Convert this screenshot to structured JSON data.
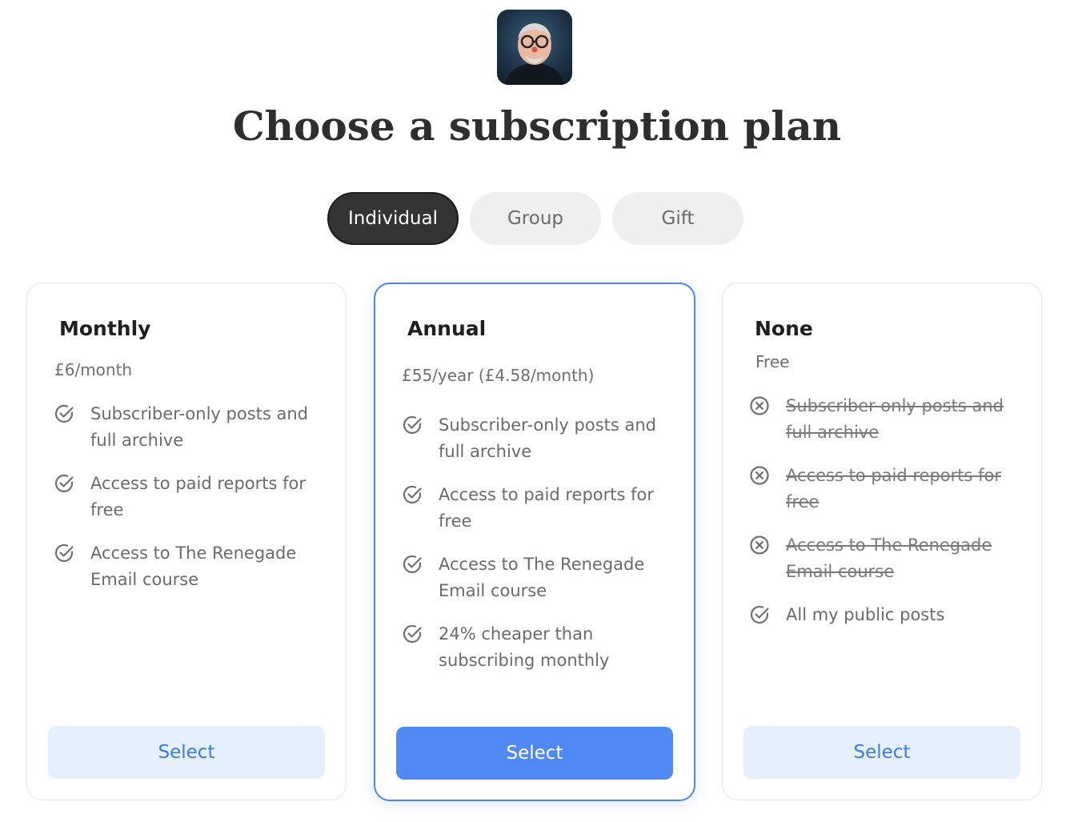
{
  "page": {
    "title": "Choose a subscription plan"
  },
  "tabs": [
    {
      "label": "Individual",
      "active": true
    },
    {
      "label": "Group",
      "active": false
    },
    {
      "label": "Gift",
      "active": false
    }
  ],
  "plans": [
    {
      "name": "Monthly",
      "price": "£6/month",
      "features": [
        {
          "text": "Subscriber-only posts and full archive",
          "included": true
        },
        {
          "text": "Access to paid reports for free",
          "included": true
        },
        {
          "text": "Access to The Renegade Email course",
          "included": true
        }
      ],
      "button": "Select"
    },
    {
      "name": "Annual",
      "price": "£55/year (£4.58/month)",
      "features": [
        {
          "text": "Subscriber-only posts and full archive",
          "included": true
        },
        {
          "text": "Access to paid reports for free",
          "included": true
        },
        {
          "text": "Access to The Renegade Email course",
          "included": true
        },
        {
          "text": "24% cheaper than subscribing monthly",
          "included": true
        }
      ],
      "button": "Select"
    },
    {
      "name": "None",
      "price": "Free",
      "features": [
        {
          "text": "Subscriber-only posts and full archive",
          "included": false
        },
        {
          "text": "Access to paid reports for free",
          "included": false
        },
        {
          "text": "Access to The Renegade Email course",
          "included": false
        },
        {
          "text": "All my public posts",
          "included": true
        }
      ],
      "button": "Select"
    }
  ],
  "colors": {
    "accent": "#5089f4",
    "accent_light": "#e6effd",
    "active_tab": "#333333"
  },
  "icons": {
    "included": "check-circle-icon",
    "excluded": "x-circle-icon"
  }
}
